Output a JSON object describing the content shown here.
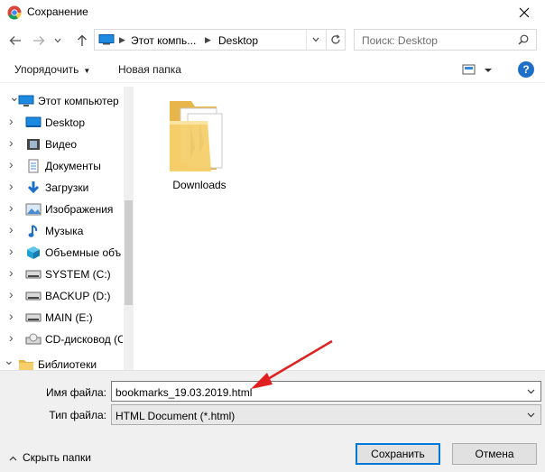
{
  "window": {
    "title": "Сохранение"
  },
  "address": {
    "crumbs": [
      "Этот компь...",
      "Desktop"
    ],
    "search_placeholder": "Поиск: Desktop"
  },
  "toolbar": {
    "organize_label": "Упорядочить",
    "new_folder_label": "Новая папка",
    "help_label": "?"
  },
  "tree": [
    {
      "label": "Этот компьютер",
      "icon": "computer-icon"
    },
    {
      "label": "Desktop",
      "icon": "desktop-icon"
    },
    {
      "label": "Видео",
      "icon": "video-icon"
    },
    {
      "label": "Документы",
      "icon": "documents-icon"
    },
    {
      "label": "Загрузки",
      "icon": "downloads-icon"
    },
    {
      "label": "Изображения",
      "icon": "pictures-icon"
    },
    {
      "label": "Музыка",
      "icon": "music-icon"
    },
    {
      "label": "Объемные объ",
      "icon": "3d-objects-icon"
    },
    {
      "label": "SYSTEM (C:)",
      "icon": "drive-icon"
    },
    {
      "label": "BACKUP (D:)",
      "icon": "drive-icon"
    },
    {
      "label": "MAIN (E:)",
      "icon": "drive-icon"
    },
    {
      "label": "CD-дисковод (С",
      "icon": "cd-drive-icon"
    },
    {
      "label": "Библиотеки",
      "icon": "libraries-icon"
    }
  ],
  "content": {
    "items": [
      {
        "name": "Downloads",
        "icon": "folder-icon"
      }
    ]
  },
  "form": {
    "filename_label": "Имя файла:",
    "filename_value": "bookmarks_19.03.2019.html",
    "filetype_label": "Тип файла:",
    "filetype_value": "HTML Document (*.html)"
  },
  "footer": {
    "hide_folders_label": "Скрыть папки",
    "save_label": "Сохранить",
    "cancel_label": "Отмена"
  },
  "colors": {
    "accent": "#0078d7",
    "annotation_arrow": "#e02020",
    "folder": "#f2c55c"
  }
}
